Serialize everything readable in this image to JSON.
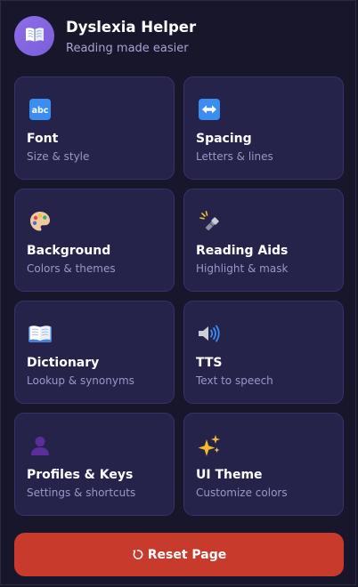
{
  "header": {
    "title": "Dyslexia Helper",
    "subtitle": "Reading made easier",
    "logo_icon": "open-book-icon"
  },
  "colors": {
    "background": "#17162a",
    "card": "#25234a",
    "accent": "#8f6ce8",
    "reset": "#c83a2c"
  },
  "cards": [
    {
      "title": "Font",
      "desc": "Size & style",
      "icon": "abc-icon"
    },
    {
      "title": "Spacing",
      "desc": "Letters & lines",
      "icon": "left-right-arrow-icon"
    },
    {
      "title": "Background",
      "desc": "Colors & themes",
      "icon": "palette-icon"
    },
    {
      "title": "Reading Aids",
      "desc": "Highlight & mask",
      "icon": "flashlight-icon"
    },
    {
      "title": "Dictionary",
      "desc": "Lookup & synonyms",
      "icon": "open-book-icon"
    },
    {
      "title": "TTS",
      "desc": "Text to speech",
      "icon": "speaker-icon"
    },
    {
      "title": "Profiles & Keys",
      "desc": "Settings & shortcuts",
      "icon": "person-silhouette-icon"
    },
    {
      "title": "UI Theme",
      "desc": "Customize colors",
      "icon": "sparkles-icon"
    }
  ],
  "reset": {
    "label": "Reset Page",
    "icon": "refresh-icon"
  }
}
